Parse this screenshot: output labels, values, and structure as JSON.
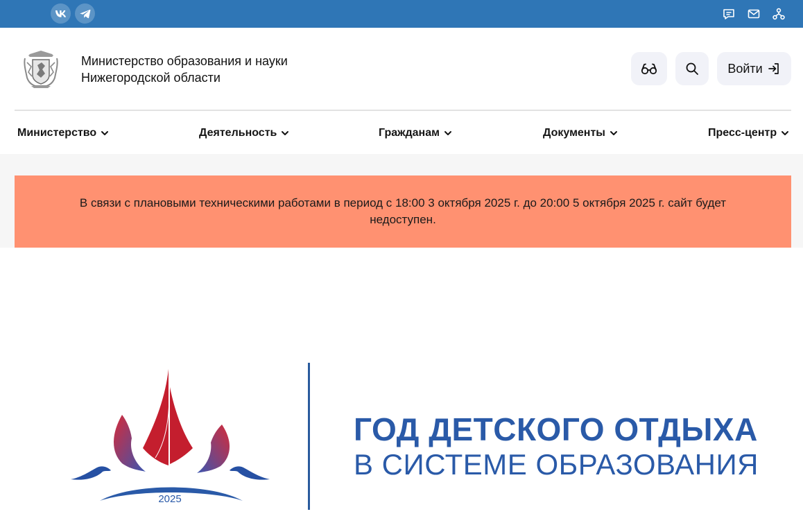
{
  "topbar": {
    "social": [
      {
        "name": "vk",
        "label": "VK",
        "icon": "vk-icon"
      },
      {
        "name": "telegram",
        "icon": "telegram-icon"
      }
    ],
    "icons": [
      "chat-icon",
      "mail-icon",
      "sitemap-icon"
    ],
    "color": "#2f76b6"
  },
  "header": {
    "org_line1": "Министерство образования и науки",
    "org_line2": "Нижегородской области",
    "login_label": "Войти",
    "buttons": [
      "glasses-icon",
      "search-icon",
      "login-icon"
    ]
  },
  "nav": {
    "items": [
      {
        "label": "Министерство"
      },
      {
        "label": "Деятельность"
      },
      {
        "label": "Гражданам"
      },
      {
        "label": "Документы"
      },
      {
        "label": "Пресс-центр"
      }
    ]
  },
  "alert": {
    "text": "В связи с плановыми техническими работами в период с 18:00 3 октября 2025 г. до 20:00 5 октября 2025 г. сайт будет недоступен.",
    "color": "#ff9171"
  },
  "banner": {
    "year": "2025",
    "title": "ГОД ДЕТСКОГО ОТДЫХА",
    "subtitle": "В СИСТЕМЕ ОБРАЗОВАНИЯ",
    "accent": "#2a5aa8"
  }
}
